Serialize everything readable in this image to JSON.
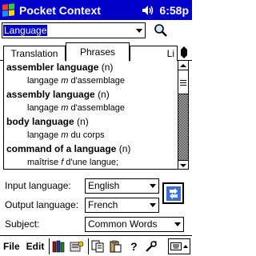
{
  "app": {
    "title": "Pocket Context",
    "time": "6:58p"
  },
  "search": {
    "value": "Language"
  },
  "tabs": [
    {
      "label": "Translation"
    },
    {
      "label": "Phrases"
    },
    {
      "label": "Li"
    }
  ],
  "phrases": [
    {
      "term": "assembler language",
      "pos": "(n)",
      "translation": "langage ",
      "gender": "m",
      "rest": " d'assemblage"
    },
    {
      "term": "assembly language",
      "pos": "(n)",
      "translation": "langage ",
      "gender": "m",
      "rest": " d'assemblage"
    },
    {
      "term": "body language",
      "pos": "(n)",
      "translation": "langage ",
      "gender": "m",
      "rest": " du corps"
    },
    {
      "term": "command of a language",
      "pos": "(n)",
      "translation": "maîtrise ",
      "gender": "f",
      "rest": " d'une langue;"
    }
  ],
  "settings": {
    "input_label": "Input language:",
    "input_value": "English",
    "output_label": "Output language:",
    "output_value": "French",
    "subject_label": "Subject:",
    "subject_value": "Common Words"
  },
  "menu": {
    "file": "File",
    "edit": "Edit",
    "help": "?"
  },
  "colors": {
    "titlebar": "#0000c8",
    "selection": "#0000c8"
  }
}
